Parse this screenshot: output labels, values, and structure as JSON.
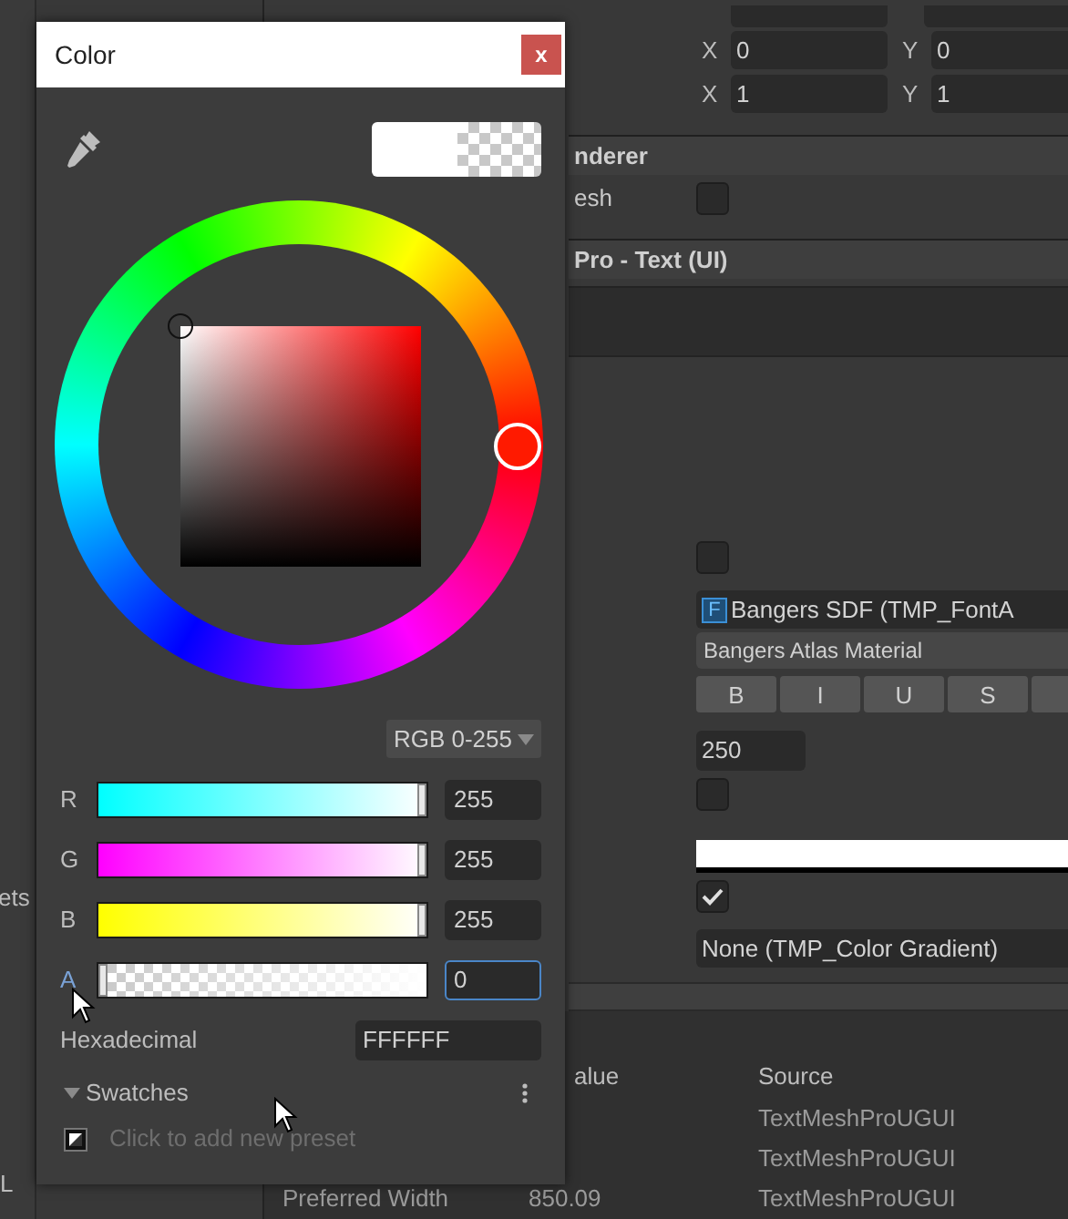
{
  "left_panel": {
    "texts": [
      "ets",
      "L"
    ]
  },
  "inspector": {
    "rows": [
      {
        "kind": "vector",
        "x_label": "X",
        "x_value": "0",
        "y_label": "Y",
        "y_value": "0"
      },
      {
        "kind": "vector",
        "x_label": "X",
        "x_value": "1",
        "y_label": "Y",
        "y_value": "1"
      },
      {
        "kind": "header",
        "label": "nderer"
      },
      {
        "kind": "checkbox",
        "label": "esh",
        "checked": false
      },
      {
        "kind": "header",
        "label": "Pro - Text (UI)"
      },
      {
        "kind": "textarea"
      },
      {
        "kind": "checkbox",
        "checked": false
      },
      {
        "kind": "object",
        "icon_text": "F",
        "label": "Bangers SDF (TMP_FontA"
      },
      {
        "kind": "dropdown",
        "label": "Bangers Atlas Material"
      },
      {
        "kind": "toggles",
        "items": [
          "B",
          "I",
          "U",
          "S"
        ]
      },
      {
        "kind": "number",
        "value": "250"
      },
      {
        "kind": "checkbox",
        "checked": false
      },
      {
        "kind": "color"
      },
      {
        "kind": "checkbox",
        "checked": true
      },
      {
        "kind": "object",
        "label": "None (TMP_Color Gradient)"
      }
    ]
  },
  "layout_panel": {
    "columns": [
      "alue",
      "Source"
    ],
    "rows": [
      {
        "name": "",
        "value": "",
        "source": "TextMeshProUGUI"
      },
      {
        "name": "",
        "value": "",
        "source": "TextMeshProUGUI"
      },
      {
        "name": "Preferred Width",
        "value": "850.09",
        "source": "TextMeshProUGUI"
      }
    ]
  },
  "color_picker": {
    "title": "Color",
    "close": "x",
    "mode": "RGB 0-255",
    "channels": [
      {
        "kind": "r",
        "label": "R",
        "level": 1,
        "value": "255",
        "focused": false
      },
      {
        "kind": "g",
        "label": "G",
        "level": 1,
        "value": "255",
        "focused": false
      },
      {
        "kind": "b",
        "label": "B",
        "level": 1,
        "value": "255",
        "focused": false
      },
      {
        "kind": "a",
        "label": "A",
        "level": 0,
        "value": "0",
        "focused": true
      }
    ],
    "hex_label": "Hexadecimal",
    "hex_value": "FFFFFF",
    "swatches": {
      "label": "Swatches",
      "expanded": true,
      "hint": "Click to add new preset"
    }
  }
}
